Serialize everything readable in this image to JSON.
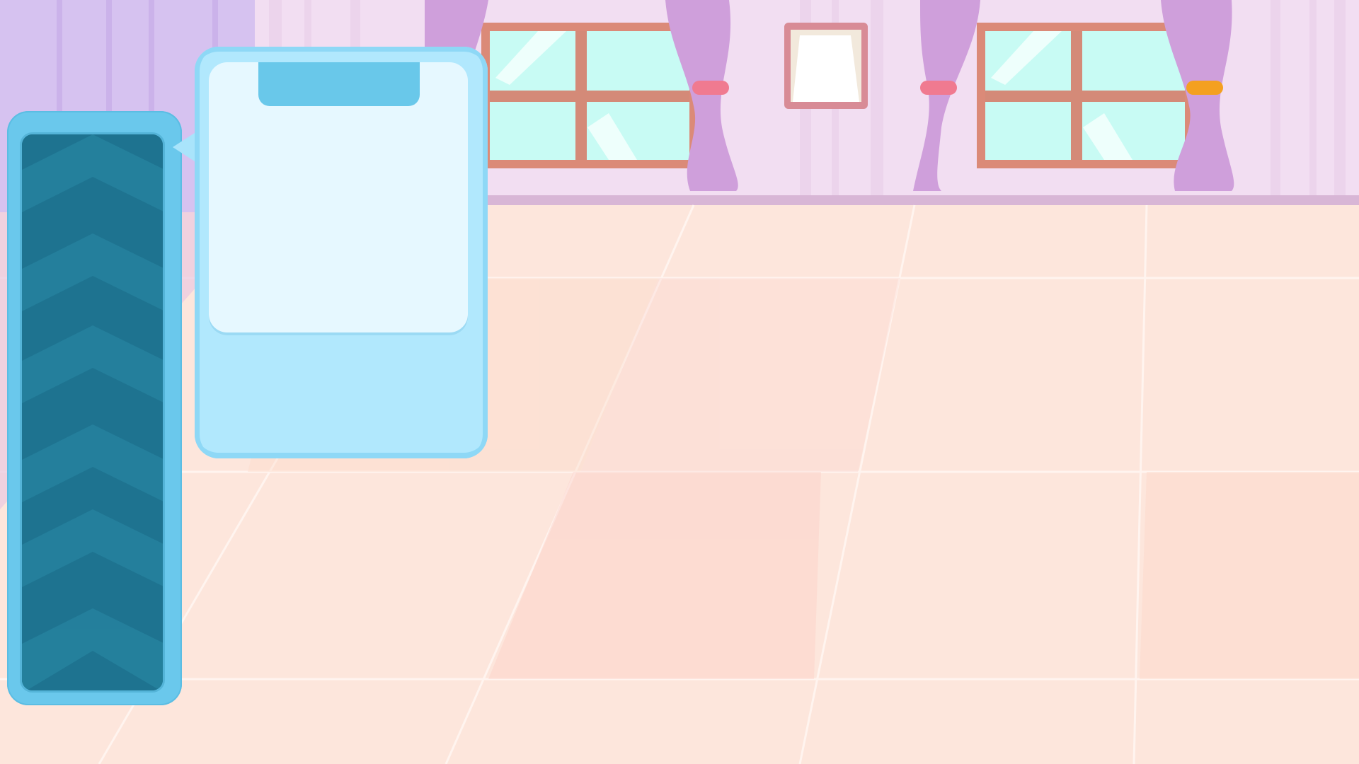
{
  "scene": {
    "name": "bedroom",
    "colors": {
      "wall": "#f2def2",
      "wall_stripe": "#ecd4ec",
      "floor": "#fde6dc",
      "curtain": "#cf9fdb",
      "window_frame": "#db8a78",
      "glass": "#c8fbf4",
      "left_drape": "#d6c2f0",
      "tie_pink": "#f07a90",
      "tie_orange": "#f4a020",
      "panel_frame": "#6ac8ec",
      "panel_inner": "#1e7390",
      "card": "#b1e8fd",
      "card_screen": "#e6f8ff",
      "card_tab": "#69c8ea"
    }
  },
  "ui": {
    "side_panel": {
      "icon": "chevron-pattern"
    },
    "card": {
      "icon": "speech-pointer"
    }
  }
}
